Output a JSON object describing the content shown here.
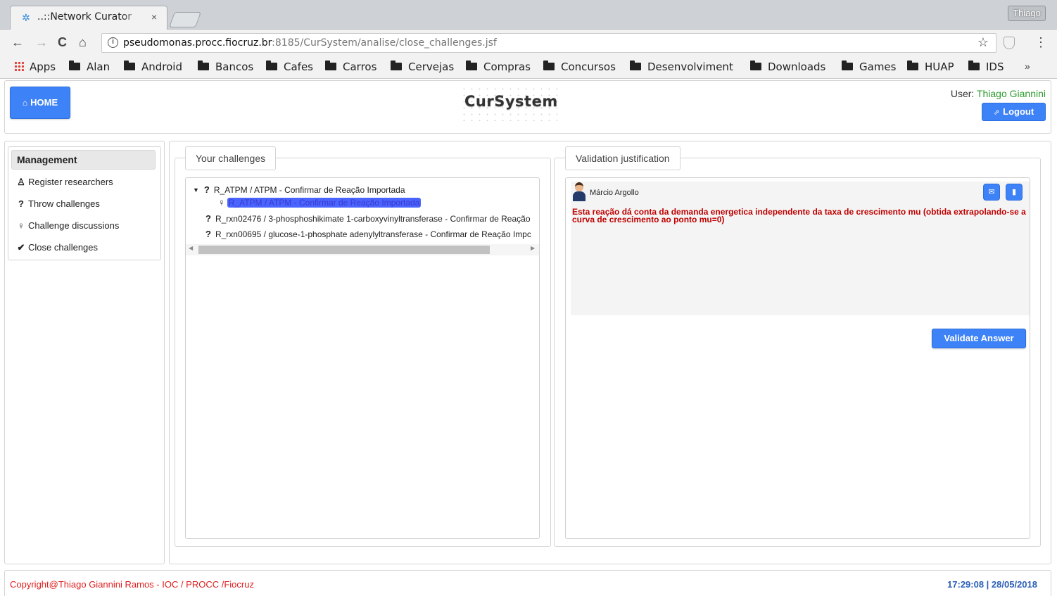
{
  "browser": {
    "tab_title": "..::Network Curator",
    "tab_close": "×",
    "profile_name": "Thiago",
    "url_host": "pseudomonas.procc.fiocruz.br",
    "url_rest": ":8185/CurSystem/analise/close_challenges.jsf",
    "info_glyph": "i",
    "back_glyph": "←",
    "forward_glyph": "→",
    "reload_glyph": "C",
    "home_glyph": "⌂",
    "star_glyph": "☆",
    "menu_glyph": "⋮",
    "bookmarks": [
      "Apps",
      "Alan",
      "Android",
      "Bancos",
      "Cafes",
      "Carros",
      "Cervejas",
      "Compras",
      "Concursos",
      "Desenvolviment",
      "Downloads",
      "Games",
      "HUAP",
      "IDS"
    ],
    "bookmarks_more": "»",
    "icons": {
      "favicon": "network-icon",
      "apps": "apps-grid-icon",
      "folder": "folder-icon",
      "extension": "shield-extension-icon"
    }
  },
  "header": {
    "home_label": "HOME",
    "home_icon": "⌂",
    "logo_text": "CurSystem",
    "user_prefix": "User: ",
    "user_name": "Thiago Giannini",
    "logout_label": "Logout",
    "logout_icon": "⇗"
  },
  "sidebar": {
    "title": "Management",
    "items": [
      {
        "icon": "♙",
        "icon_name": "user-icon",
        "label": "Register researchers"
      },
      {
        "icon": "?",
        "icon_name": "question-icon",
        "label": "Throw challenges"
      },
      {
        "icon": "♀",
        "icon_name": "lightbulb-icon",
        "label": "Challenge discussions"
      },
      {
        "icon": "✔",
        "icon_name": "check-icon",
        "label": "Close challenges"
      }
    ]
  },
  "challenges": {
    "legend": "Your challenges",
    "tree": [
      {
        "expander": "▼",
        "marker": "?",
        "label": "R_ATPM / ATPM - Confirmar de Reação Importada"
      },
      {
        "marker": "♀",
        "label": "R_ATPM / ATPM - Confirmar de Reação Importada",
        "selected": true
      },
      {
        "marker": "?",
        "label": "R_rxn02476 / 3-phosphoshikimate 1-carboxyvinyltransferase - Confirmar de Reação"
      },
      {
        "marker": "?",
        "label": "R_rxn00695 / glucose-1-phosphate adenylyltransferase - Confirmar de Reação Impc"
      }
    ],
    "scroll_left": "◀",
    "scroll_right": "▶"
  },
  "justification": {
    "legend": "Validation justification",
    "author": "Márcio Argollo",
    "message": "Esta reação dá conta da demanda energetica independente da taxa de crescimento mu (obtida extrapolando-se a curva de crescimento ao ponto mu=0)",
    "comment_icon": "✉",
    "delete_icon": "▮",
    "validate_label": "Validate Answer"
  },
  "footer": {
    "copyright": "Copyright@Thiago Giannini Ramos - IOC / PROCC /Fiocruz",
    "clock": "17:29:08 | 28/05/2018"
  },
  "colors": {
    "accent": "#3e82f7",
    "user_name": "#2e9b2e",
    "message": "#c00000",
    "copyright": "#e02020",
    "clock": "#2b5fb6",
    "selection": "#4a64ff"
  }
}
